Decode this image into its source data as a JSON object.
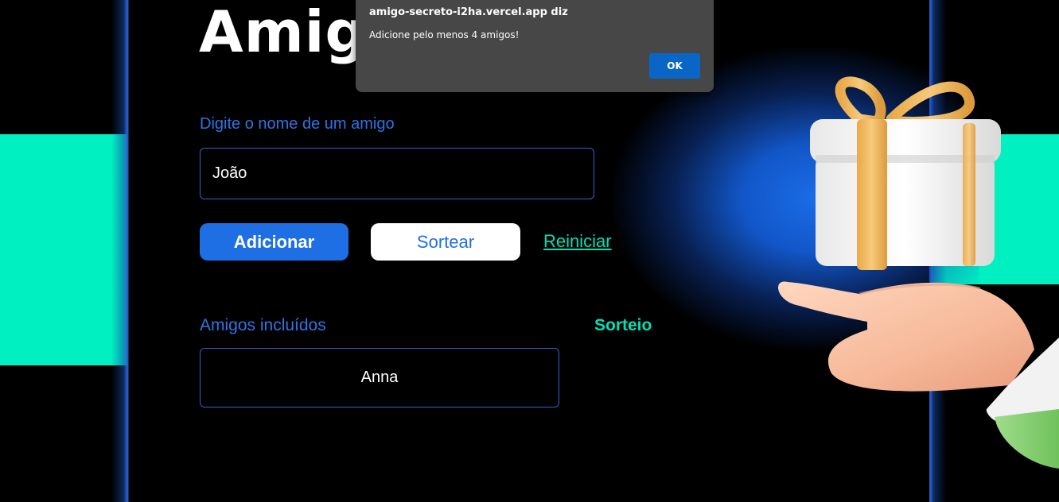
{
  "header": {
    "title": "Amigo"
  },
  "form": {
    "name_label": "Digite o nome de um amigo",
    "name_value": "João",
    "add_button": "Adicionar",
    "draw_button": "Sortear",
    "reset_link": "Reiniciar"
  },
  "friends": {
    "heading": "Amigos incluídos",
    "items": [
      "Anna"
    ]
  },
  "draw_result": {
    "heading": "Sorteio"
  },
  "alert": {
    "title": "amigo-secreto-i2ha.vercel.app diz",
    "message": "Adicione pelo menos 4 amigos!",
    "ok_label": "OK"
  },
  "colors": {
    "background": "#000000",
    "accent_teal": "#00f0c2",
    "accent_blue": "#1f6fe4",
    "dialog_bg": "#474747",
    "dialog_button": "#0a66c6"
  },
  "icons": {
    "illustration": "gift-on-hand-illustration"
  }
}
